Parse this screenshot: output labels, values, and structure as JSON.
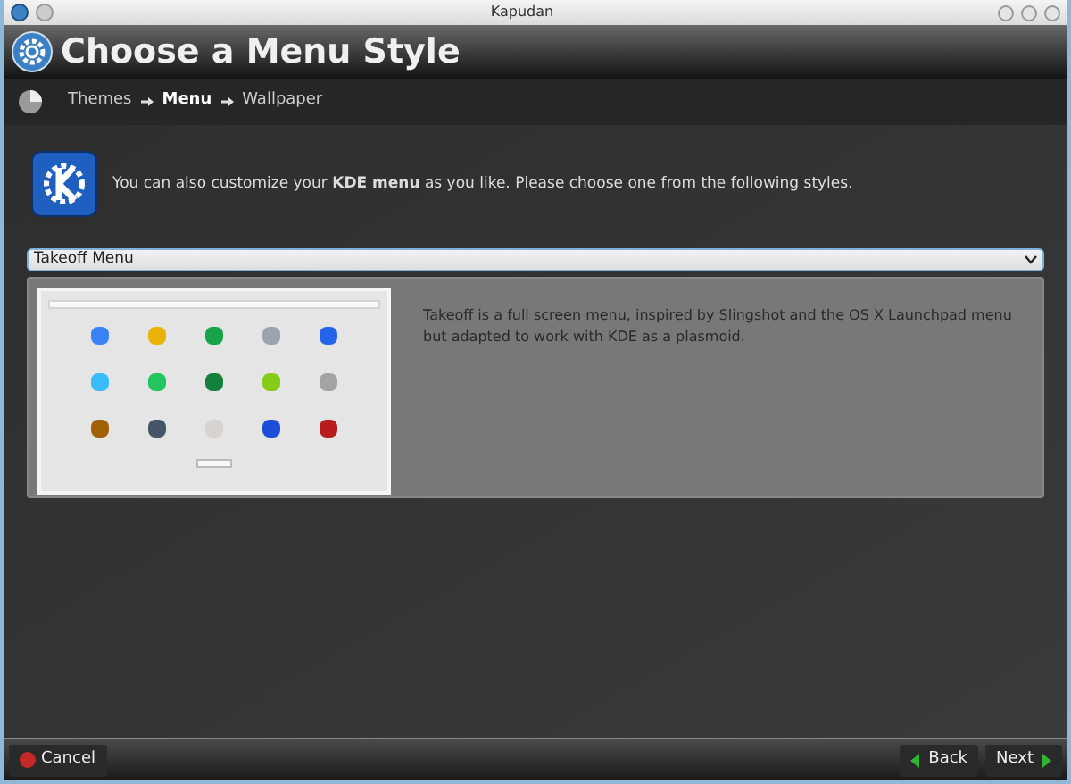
{
  "window": {
    "title": "Kapudan"
  },
  "header": {
    "title": "Choose a Menu Style"
  },
  "breadcrumb": [
    {
      "label": "Themes",
      "selected": false
    },
    {
      "label": "Menu",
      "selected": true
    },
    {
      "label": "Wallpaper",
      "selected": false
    }
  ],
  "intro": "You can also customize your **KDE menu** as you like. Please choose one from the following styles.",
  "style_select": {
    "value": "Takeoff Menu"
  },
  "description": "Takeoff is a full screen menu, inspired by Slingshot and the OS X Launchpad menu but adapted to work with KDE as a plasmoid.",
  "buttons": {
    "cancel": "Cancel",
    "back": "Back",
    "next": "Next"
  }
}
